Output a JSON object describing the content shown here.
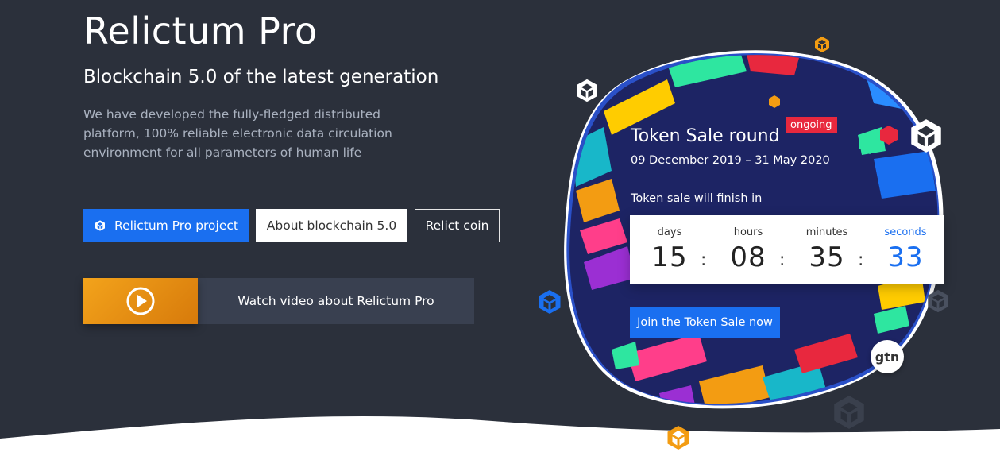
{
  "hero": {
    "title": "Relictum Pro",
    "subtitle": "Blockchain 5.0 of the latest generation",
    "description": "We have developed the fully-fledged distributed platform, 100% reliable electronic data circulation environment for all parameters of human life"
  },
  "buttons": {
    "project": "Relictum Pro project",
    "about": "About blockchain 5.0",
    "coin": "Relict coin"
  },
  "video": {
    "label": "Watch video about Relictum Pro"
  },
  "token_sale": {
    "title": "Token Sale round",
    "badge": "ongoing",
    "dates": "09 December 2019 – 31 May 2020",
    "finish_label": "Token sale will finish in",
    "countdown": [
      {
        "label": "days",
        "value": "15"
      },
      {
        "label": "hours",
        "value": "08"
      },
      {
        "label": "minutes",
        "value": "35"
      },
      {
        "label": "seconds",
        "value": "33"
      }
    ],
    "separator": ":",
    "join_label": "Join the Token Sale now",
    "partner_logo": "gtn"
  },
  "colors": {
    "background": "#2b303b",
    "primary": "#1a6ff0",
    "badge": "#e8283e",
    "orange": "#f39c12"
  }
}
